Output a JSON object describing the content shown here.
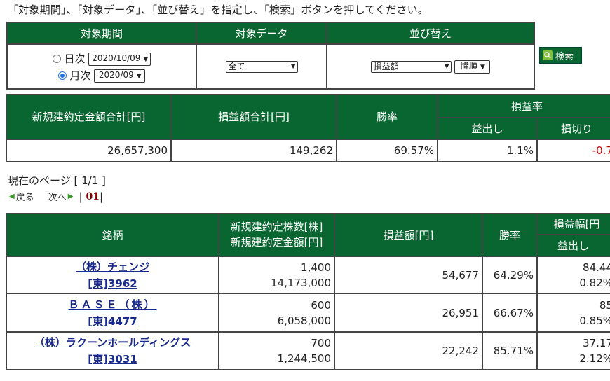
{
  "instruction": "「対象期間」、「対象データ」、「並び替え」を指定し、「検索」ボタンを押してください。",
  "criteria": {
    "headers": [
      "対象期間",
      "対象データ",
      "並び替え"
    ],
    "daily_label": "日次",
    "daily_value": "2020/10/09",
    "monthly_label": "月次",
    "monthly_value": "2020/09",
    "selected_period": "月次",
    "data_value": "全て",
    "sort_value": "損益額",
    "order_value": "降順"
  },
  "search_button": "検索",
  "summary": {
    "headers": {
      "total_amount": "新規建約定金額合計[円]",
      "total_pl": "損益額合計[円]",
      "win_rate": "勝率",
      "pl_rate": "損益率",
      "profit": "益出し",
      "loss": "損切り"
    },
    "values": {
      "total_amount": "26,657,300",
      "total_pl": "149,262",
      "win_rate": "69.57%",
      "profit": "1.1%",
      "loss": "-0.7"
    }
  },
  "pagination": {
    "current_page": "現在のページ [ 1/1 ]",
    "prev": "戻る",
    "next": "次へ",
    "page_num": "01"
  },
  "stocks_table": {
    "headers": {
      "name": "銘柄",
      "shares": "新規建約定株数[株]",
      "amount": "新規建約定金額[円]",
      "pl": "損益額[円]",
      "win_rate": "勝率",
      "pl_width": "損益幅[円",
      "profit": "益出し"
    },
    "rows": [
      {
        "name": "（株）チェンジ",
        "code": "[東]3962",
        "shares": "1,400",
        "amount": "14,173,000",
        "pl": "54,677",
        "win_rate": "64.29%",
        "profit_yen": "84.44",
        "profit_pct": "0.82%"
      },
      {
        "name": "ＢＡＳＥ（株）",
        "code": "[東]4477",
        "shares": "600",
        "amount": "6,058,000",
        "pl": "26,951",
        "win_rate": "66.67%",
        "profit_yen": "85",
        "profit_pct": "0.85%"
      },
      {
        "name": "（株）ラクーンホールディングス",
        "code": "[東]3031",
        "shares": "700",
        "amount": "1,244,500",
        "pl": "22,242",
        "win_rate": "85.71%",
        "profit_yen": "37.17",
        "profit_pct": "2.12%"
      }
    ]
  },
  "colors": {
    "header_bg": "#0a6630",
    "link": "#1a2a8a",
    "negative": "#d00000"
  }
}
